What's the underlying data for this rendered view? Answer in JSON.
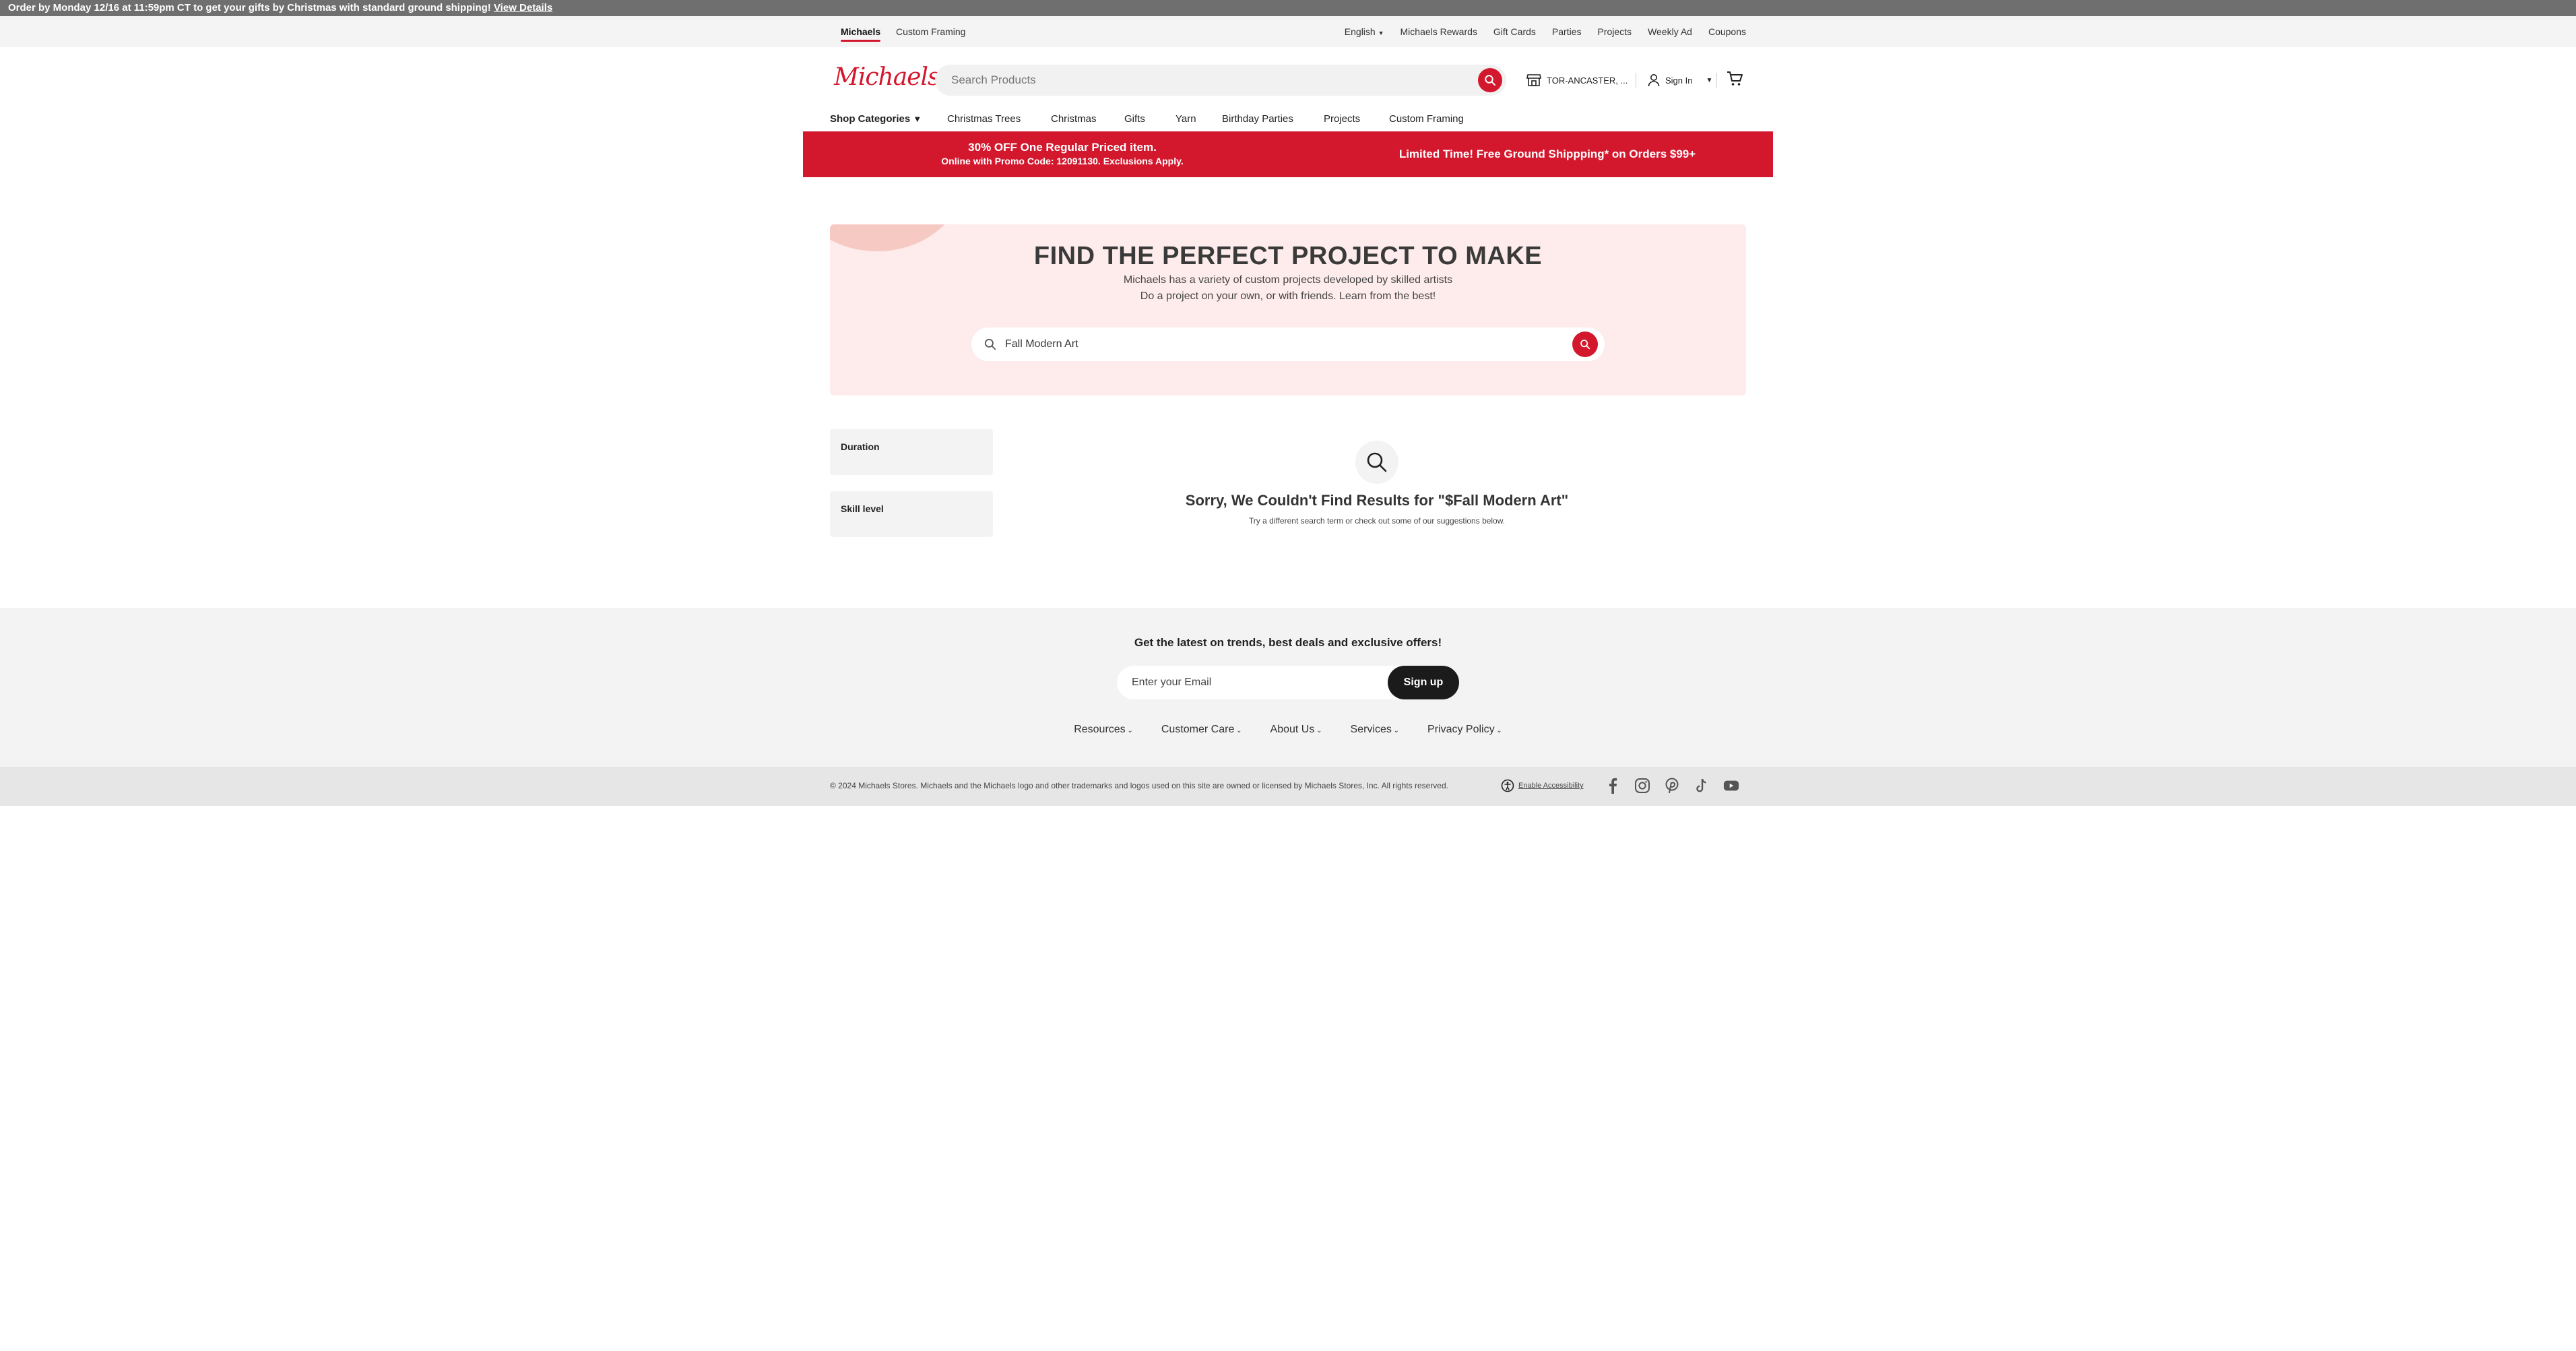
{
  "notice": {
    "text": "Order by Monday 12/16 at 11:59pm CT to get your gifts by Christmas with standard ground shipping!",
    "link": "View Details"
  },
  "utility": {
    "tabs": [
      {
        "label": "Michaels",
        "active": true
      },
      {
        "label": "Custom Framing",
        "active": false
      }
    ],
    "language": "English",
    "links": [
      "Michaels Rewards",
      "Gift Cards",
      "Parties",
      "Projects",
      "Weekly Ad",
      "Coupons"
    ]
  },
  "header": {
    "logo": "Michaels",
    "search_placeholder": "Search Products",
    "store": "TOR-ANCASTER, ...",
    "sign_in": "Sign In"
  },
  "categories": [
    "Shop Categories",
    "Christmas Trees",
    "Christmas",
    "Gifts",
    "Yarn",
    "Birthday Parties",
    "Projects",
    "Custom Framing"
  ],
  "promo": {
    "left_line1": "30% OFF One Regular Priced item.",
    "left_line2": "Online with Promo Code: 12091130. Exclusions Apply.",
    "right": "Limited Time! Free Ground Shippping* on Orders $99+"
  },
  "hero": {
    "title": "FIND THE PERFECT PROJECT TO MAKE",
    "subtitle1": "Michaels has a variety of custom projects developed by skilled artists",
    "subtitle2": "Do a project on your own, or with friends. Learn from the best!",
    "search_value": "Fall Modern Art"
  },
  "filters": [
    "Duration",
    "Skill level"
  ],
  "no_results": {
    "title": "Sorry, We Couldn't Find Results for \"$Fall Modern Art\"",
    "subtitle": "Try a different search term or check out some of our suggestions below."
  },
  "footer": {
    "headline": "Get the latest on trends, best deals and exclusive offers!",
    "email_placeholder": "Enter your Email",
    "signup": "Sign up",
    "links": [
      "Resources",
      "Customer Care",
      "About Us",
      "Services",
      "Privacy Policy"
    ],
    "legal": "© 2024 Michaels Stores. Michaels and the Michaels logo and other trademarks and logos used on this site are owned or licensed by Michaels Stores, Inc. All rights reserved.",
    "accessibility": "Enable Accessibility"
  },
  "colors": {
    "brand_red": "#d3182e",
    "hero_bg": "#fdeceb",
    "footer_bg": "#f3f3f3"
  },
  "icons": [
    "search-icon",
    "store-icon",
    "user-icon",
    "cart-icon",
    "accessibility-icon",
    "facebook-icon",
    "instagram-icon",
    "pinterest-icon",
    "tiktok-icon",
    "youtube-icon"
  ]
}
